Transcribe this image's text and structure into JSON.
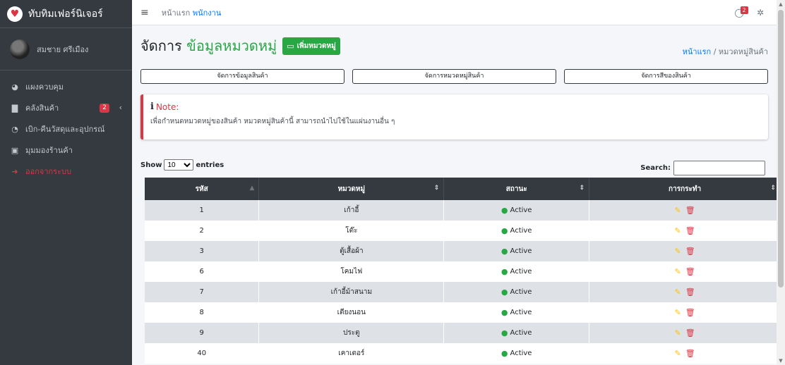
{
  "brand": {
    "name": "ทับทิมเฟอร์นิเจอร์"
  },
  "user": {
    "name": "สมชาย ศรีเมือง"
  },
  "sidebar": {
    "items": [
      {
        "label": "แผงควบคุม",
        "icon": "dashboard-icon"
      },
      {
        "label": "คลังสินค้า",
        "icon": "box-icon",
        "badge": "2"
      },
      {
        "label": "เบิก-คืนวัสดุและอุปกรณ์",
        "icon": "pie-icon"
      },
      {
        "label": "มุมมองร้านค้า",
        "icon": "monitor-icon"
      },
      {
        "label": "ออกจากระบบ",
        "icon": "logout-icon"
      }
    ]
  },
  "topbar": {
    "home": "หน้าแรก",
    "current": "พนักงาน",
    "msg_badge": "2"
  },
  "page": {
    "title_prefix": "จัดการ",
    "title_accent": "ข้อมูลหมวดหมู่",
    "add_button": "เพิ่มหมวดหมู่",
    "crumb_home": "หน้าแรก",
    "crumb_sep": "/",
    "crumb_current": "หมวดหมู่สินค้า"
  },
  "manage_buttons": [
    "จัดการข้อมูลสินค้า",
    "จัดการหมวดหมู่สินค้า",
    "จัดการสีของสินค้า"
  ],
  "note": {
    "title": "Note:",
    "text": "เพื่อกำหนดหมวดหมู่ของสินค้า หมวดหมู่สินค้านี้ สามารถนำไปใช้ในแผ่นงานอื่น ๆ"
  },
  "datatable": {
    "show_label": "Show",
    "entries_label": "entries",
    "page_size": "10",
    "search_label": "Search:",
    "search_value": ""
  },
  "table": {
    "headers": [
      "รหัส",
      "หมวดหมู่",
      "สถานะ",
      "การกระทำ"
    ],
    "rows": [
      {
        "id": "1",
        "name": "เก้าอี้",
        "status": "Active"
      },
      {
        "id": "2",
        "name": "โต๊ะ",
        "status": "Active"
      },
      {
        "id": "3",
        "name": "ตู้เสื้อผ้า",
        "status": "Active"
      },
      {
        "id": "6",
        "name": "โคมไฟ",
        "status": "Active"
      },
      {
        "id": "7",
        "name": "เก้าอี้ม้าสนาม",
        "status": "Active"
      },
      {
        "id": "8",
        "name": "เตียงนอน",
        "status": "Active"
      },
      {
        "id": "9",
        "name": "ประตู",
        "status": "Active"
      },
      {
        "id": "40",
        "name": "เคาเตอร์",
        "status": "Active"
      }
    ]
  },
  "colors": {
    "accent": "#28a745",
    "danger": "#dc3545",
    "sidebar": "#343a40",
    "link": "#007bff"
  }
}
